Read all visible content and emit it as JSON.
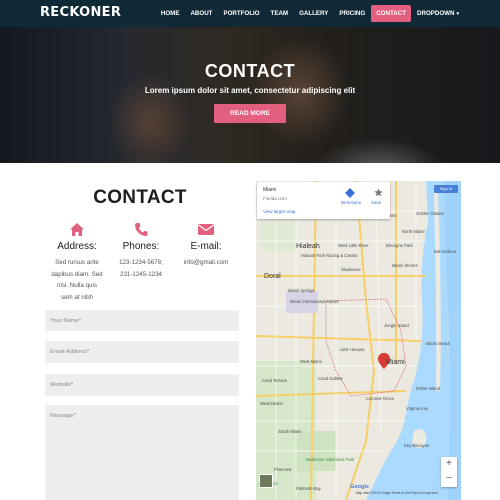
{
  "brand": "RECKONER",
  "nav": {
    "items": [
      "HOME",
      "ABOUT",
      "PORTFOLIO",
      "TEAM",
      "GALLERY",
      "PRICING",
      "CONTACT",
      "DROPDOWN"
    ],
    "active": "CONTACT"
  },
  "hero": {
    "title": "CONTACT",
    "subtitle": "Lorem ipsum dolor sit amet, consectetur adipiscing elit",
    "button": "READ MORE"
  },
  "contact": {
    "heading": "CONTACT",
    "columns": [
      {
        "icon": "home-icon",
        "title": "Address:",
        "lines": [
          "Sed rursus ante",
          "dapibus diam. Sed",
          "nisi. Nulla quis",
          "sem at nibh"
        ]
      },
      {
        "icon": "phone-icon",
        "title": "Phones:",
        "lines": [
          "123-1234-5678;",
          "231-1245-1234"
        ]
      },
      {
        "icon": "envelope-icon",
        "title": "E-mail:",
        "lines": [
          "info@gmail.com"
        ]
      }
    ],
    "form": {
      "name_placeholder": "Your Name*",
      "email_placeholder": "Email Address*",
      "website_placeholder": "Website*",
      "message_placeholder": "Message*"
    }
  },
  "map": {
    "place_title": "Miami",
    "place_subtitle": "Florida USA",
    "directions": "Directions",
    "save": "Save",
    "larger_map": "View larger map",
    "sign_in": "Sign in",
    "zoom_in": "+",
    "zoom_out": "−",
    "google": "Google",
    "map_data": "Map data ©2019 Google   Terms of Use   Report a map error",
    "labels": {
      "miami_gardens": "Miami Gardens",
      "hialeah": "Hialeah",
      "west_little_river": "West Little River",
      "miami_shores": "Miami Shores",
      "north_miami": "North Miami",
      "opa_locka": "Opa-locka",
      "golden_glades": "Golden Glades",
      "bal_harbour": "Bal Harbour",
      "biscayne_park": "Biscayne Park",
      "hialeah_park": "Hialeah Park Racing & Casino",
      "gladeview": "Gladeview",
      "doral": "Doral",
      "miami_springs": "Miami Springs",
      "airport": "Miami International Airport",
      "miami": "Miami",
      "miami_beach": "Miami Beach",
      "little_havana": "Little Havana",
      "coral_gables": "Coral Gables",
      "coral_terrace": "Coral Terrace",
      "westchester": "Westchester",
      "south_miami": "South Miami",
      "pinecrest": "Pinecrest",
      "palmetto_bay": "Palmetto Bay",
      "key_biscayne": "Key Biscayne",
      "fisher_island": "Fisher Island",
      "jungle_island": "Jungle Island",
      "zoo_miami": "Zoo Miami",
      "hammock_park": "Matheson Hammock Park",
      "coconut_grove": "Coconut Grove",
      "west_miami": "West Miami",
      "virginia_key": "Virginia Key"
    }
  }
}
